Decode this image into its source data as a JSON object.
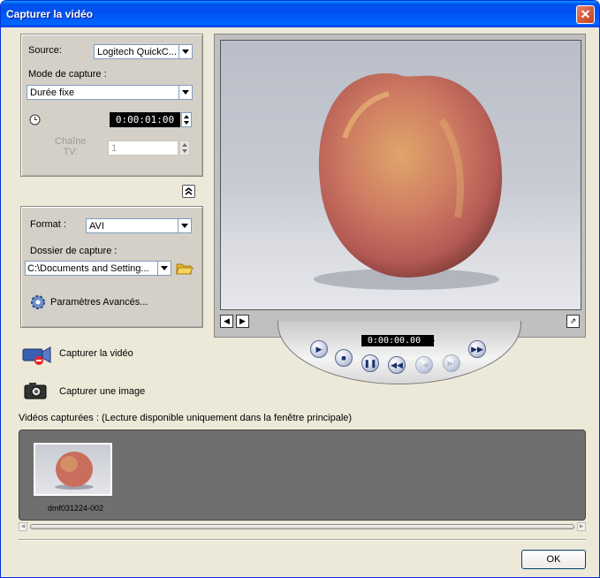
{
  "window": {
    "title": "Capturer la vidéo",
    "close_glyph": "✕"
  },
  "capture_settings": {
    "source_label": "Source:",
    "source_value": "Logitech QuickC...",
    "mode_label": "Mode de capture :",
    "mode_value": "Durée fixe",
    "duration_value": "0:00:01:00",
    "channel_label_line1": "Chaîne",
    "channel_label_line2": "TV:",
    "channel_value": "1"
  },
  "format_settings": {
    "format_label": "Format :",
    "format_value": "AVI",
    "folder_label": "Dossier de capture :",
    "folder_value": "C:\\Documents and Setting...",
    "advanced_label": "Paramètres Avancés..."
  },
  "actions": {
    "capture_video_label": "Capturer la vidéo",
    "capture_image_label": "Capturer une image"
  },
  "player": {
    "timecode": "0:00:00.00"
  },
  "captured": {
    "header": "Vidéos capturées : (Lecture disponible uniquement dans la fenêtre principale)",
    "items": [
      {
        "name": "dmf031224-002"
      }
    ]
  },
  "footer": {
    "ok_label": "OK"
  },
  "icons": {
    "clock": "clock-icon",
    "folder": "folder-icon",
    "gear": "gear-icon",
    "camcorder": "camcorder-icon",
    "camera": "camera-icon",
    "collapse": "collapse-up-icon"
  }
}
